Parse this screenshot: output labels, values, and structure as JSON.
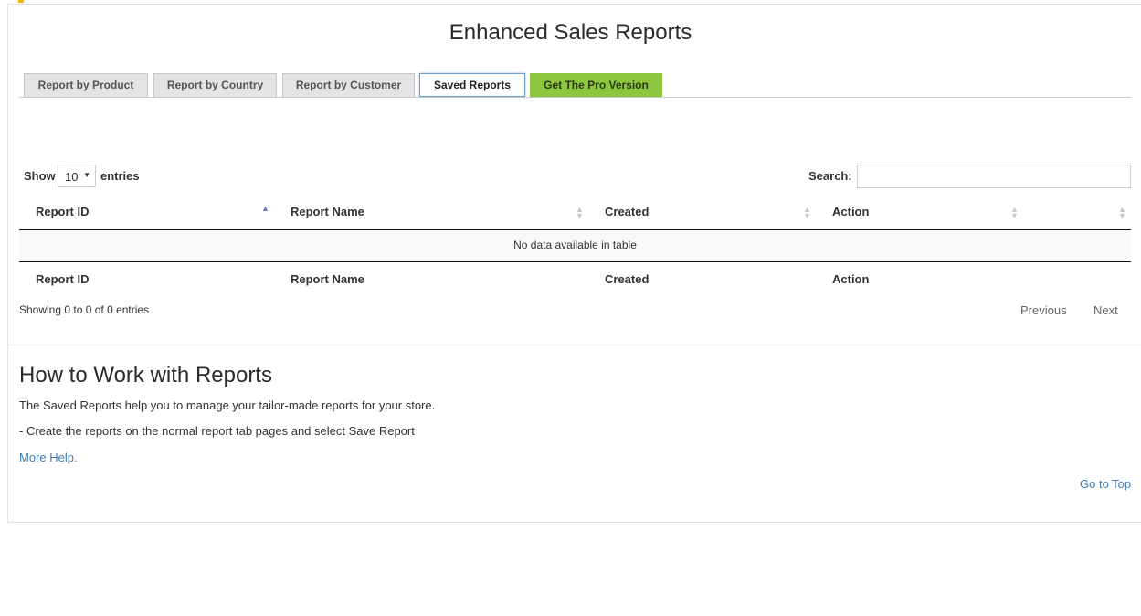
{
  "page": {
    "title": "Enhanced Sales Reports"
  },
  "tabs": [
    {
      "label": "Report by Product"
    },
    {
      "label": "Report by Country"
    },
    {
      "label": "Report by Customer"
    },
    {
      "label": "Saved Reports",
      "active": true
    },
    {
      "label": "Get The Pro Version"
    }
  ],
  "colors": {
    "pro_tab": "#8dc63f",
    "active_tab_border": "#6d9fd3",
    "link": "#3f7cb4",
    "sort_active": "#6b78c7"
  },
  "table_controls": {
    "show_label": "Show",
    "entries_value": "10",
    "entries_label": "entries",
    "search_label": "Search:",
    "search_value": ""
  },
  "table": {
    "columns": [
      "Report ID",
      "Report Name",
      "Created",
      "Action",
      ""
    ],
    "empty_message": "No data available in table",
    "footer_columns": [
      "Report ID",
      "Report Name",
      "Created",
      "Action"
    ],
    "info": "Showing 0 to 0 of 0 entries",
    "previous_label": "Previous",
    "next_label": "Next"
  },
  "help": {
    "title": "How to Work with Reports",
    "line1": "The Saved Reports help you to manage your tailor-made reports for your store.",
    "line2": "- Create the reports on the normal report tab pages and select Save Report",
    "more_help": "More Help.",
    "go_to_top": "Go to Top"
  }
}
